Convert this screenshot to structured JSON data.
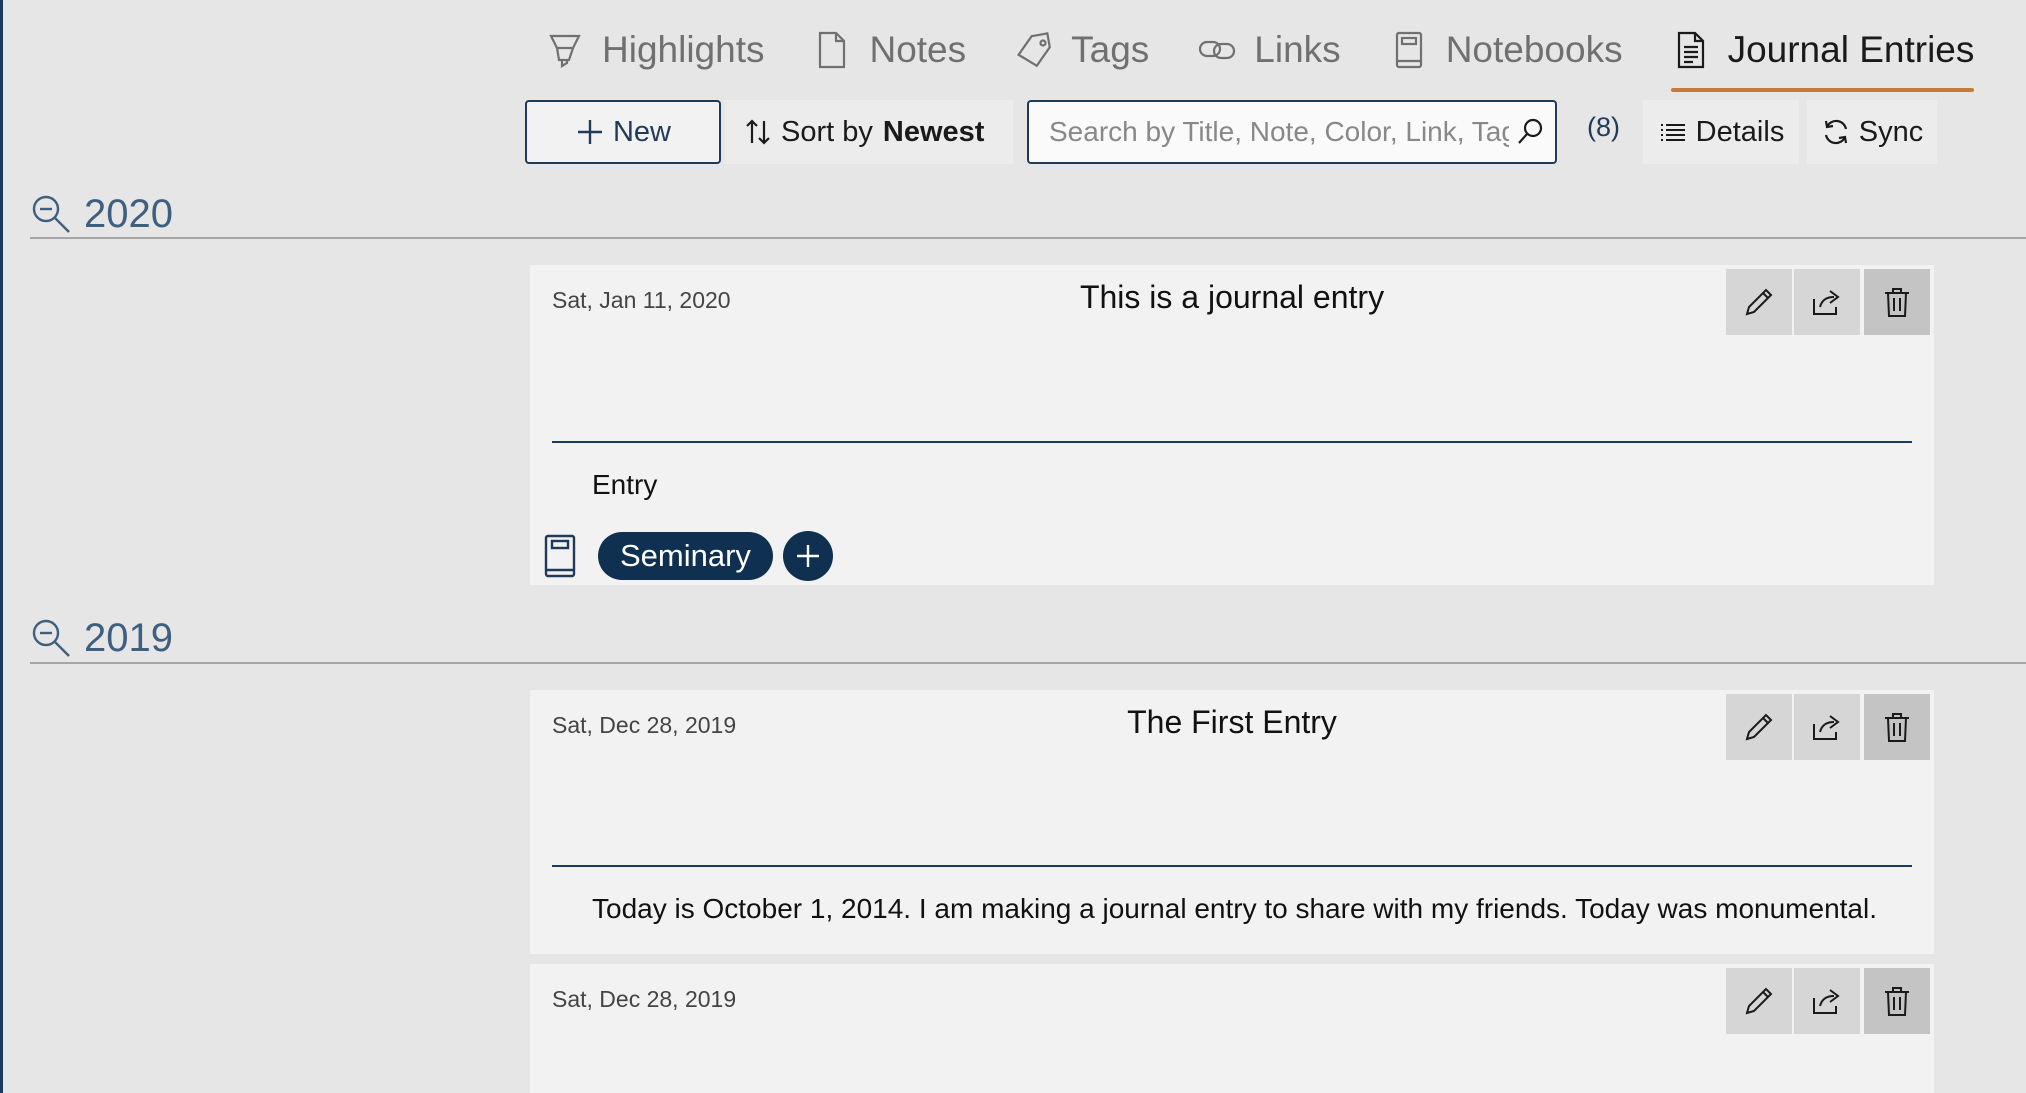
{
  "nav": {
    "tabs": [
      {
        "label": "Highlights",
        "icon": "highlighter-icon"
      },
      {
        "label": "Notes",
        "icon": "note-icon"
      },
      {
        "label": "Tags",
        "icon": "tag-icon"
      },
      {
        "label": "Links",
        "icon": "link-icon"
      },
      {
        "label": "Notebooks",
        "icon": "notebook-icon"
      },
      {
        "label": "Journal Entries",
        "icon": "journal-icon",
        "active": true
      }
    ]
  },
  "toolbar": {
    "new_label": "New",
    "sort_prefix": "Sort by",
    "sort_value": "Newest",
    "search_placeholder": "Search by Title, Note, Color, Link, Tag",
    "count": "(8)",
    "details_label": "Details",
    "sync_label": "Sync"
  },
  "groups": [
    {
      "year": "2020",
      "entries": [
        {
          "date": "Sat, Jan 11, 2020",
          "title": "This is a journal entry",
          "body": "Entry",
          "tags": [
            "Seminary"
          ]
        }
      ]
    },
    {
      "year": "2019",
      "entries": [
        {
          "date": "Sat, Dec 28, 2019",
          "title": "The First Entry",
          "body": "Today is October 1, 2014. I am making a journal entry to share with my friends. Today was monumental."
        },
        {
          "date": "Sat, Dec 28, 2019",
          "title": "",
          "body": ""
        }
      ]
    }
  ],
  "colors": {
    "accent": "#c87a3a",
    "primary": "#0f3050",
    "border": "#1f3a5a"
  }
}
